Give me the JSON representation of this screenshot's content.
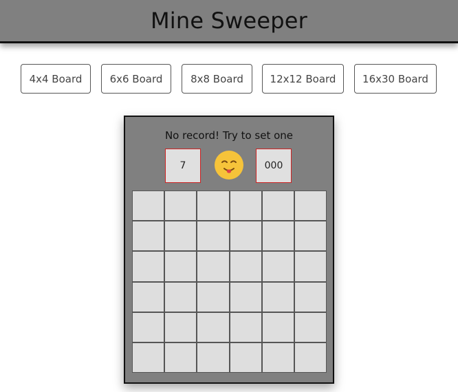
{
  "title": "Mine Sweeper",
  "board_options": [
    {
      "label": "4x4 Board"
    },
    {
      "label": "6x6 Board"
    },
    {
      "label": "8x8 Board"
    },
    {
      "label": "12x12 Board"
    },
    {
      "label": "16x30 Board"
    }
  ],
  "game": {
    "record_text": "No record! Try to set one",
    "mines_counter": "7",
    "timer": "000",
    "face_icon": "smiling-face-icon",
    "rows": 6,
    "cols": 6
  },
  "colors": {
    "header_bg": "#808080",
    "game_bg": "#808080",
    "cell_bg": "#dedede",
    "counter_border": "#cc2222",
    "face": "#f6c33a"
  }
}
